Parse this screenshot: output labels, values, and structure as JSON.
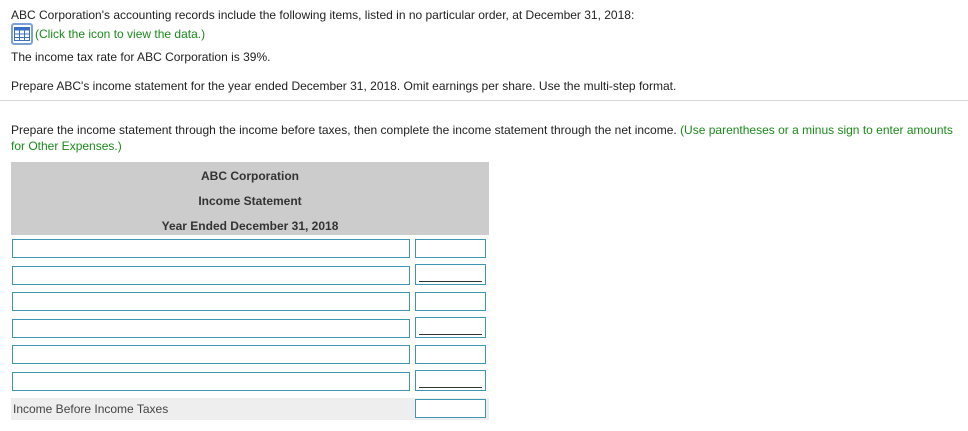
{
  "intro": {
    "records_text": "ABC Corporation's accounting records include the following items, listed in no particular order, at December 31, 2018:",
    "data_link": "(Click the icon to view the data.)",
    "tax_rate_text": "The income tax rate for ABC Corporation is 39%.",
    "task_text": "Prepare ABC's income statement for the year ended December 31, 2018. Omit earnings per share. Use the multi-step format."
  },
  "instruction": {
    "main": "Prepare the income statement through the income before taxes, then complete the income statement through the net income.",
    "hint": "(Use parentheses or a minus sign to enter amounts for Other Expenses.)"
  },
  "statement": {
    "company": "ABC Corporation",
    "title": "Income Statement",
    "period": "Year Ended December 31, 2018",
    "rows": [
      {
        "label": "",
        "amount": "",
        "underlined": false
      },
      {
        "label": "",
        "amount": "",
        "underlined": true
      },
      {
        "label": "",
        "amount": "",
        "underlined": false
      },
      {
        "label": "",
        "amount": "",
        "underlined": true
      },
      {
        "label": "",
        "amount": "",
        "underlined": false
      },
      {
        "label": "",
        "amount": "",
        "underlined": true
      }
    ],
    "summary_label": "Income Before Income Taxes",
    "summary_amount": ""
  },
  "colors": {
    "link_green": "#1a8a1a",
    "input_border": "#3c96b4",
    "header_gray": "#cccccc",
    "icon_blue": "#3a6fc8"
  },
  "icons": {
    "data_table": "table-grid-icon"
  }
}
